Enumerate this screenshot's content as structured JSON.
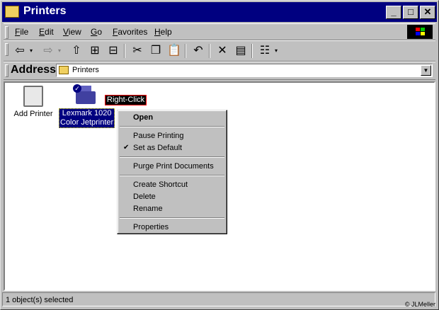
{
  "window": {
    "title": "Printers"
  },
  "title_buttons": {
    "minimize": "_",
    "maximize": "□",
    "close": "✕"
  },
  "menubar": [
    "File",
    "Edit",
    "View",
    "Go",
    "Favorites",
    "Help"
  ],
  "address": {
    "label": "Address",
    "value": "Printers"
  },
  "content": {
    "items": [
      {
        "label": "Add Printer"
      },
      {
        "label_line1": "Lexmark 1020",
        "label_line2": "Color Jetprinter"
      }
    ],
    "callout": "Right-Click"
  },
  "context_menu": {
    "items": [
      "Open",
      "Pause Printing",
      "Set as Default",
      "Purge Print Documents",
      "Create Shortcut",
      "Delete",
      "Rename",
      "Properties"
    ],
    "checked": "Set as Default"
  },
  "status": {
    "text": "1 object(s) selected",
    "copyright": "© JLMeller"
  },
  "colors": {
    "titlebar": "#000080",
    "selection": "#000080",
    "face": "#c0c0c0"
  }
}
